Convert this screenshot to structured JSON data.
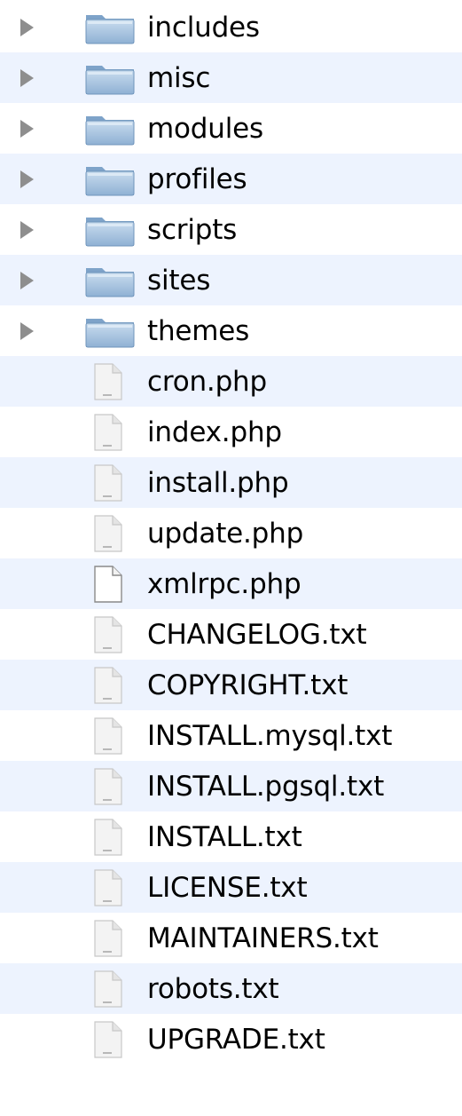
{
  "finder_list": {
    "row_colors": {
      "even": "#ffffff",
      "odd": "#edf3fe"
    },
    "items": [
      {
        "name": "includes",
        "kind": "folder",
        "icon": "folder-icon"
      },
      {
        "name": "misc",
        "kind": "folder",
        "icon": "folder-icon"
      },
      {
        "name": "modules",
        "kind": "folder",
        "icon": "folder-icon"
      },
      {
        "name": "profiles",
        "kind": "folder",
        "icon": "folder-icon"
      },
      {
        "name": "scripts",
        "kind": "folder",
        "icon": "folder-icon"
      },
      {
        "name": "sites",
        "kind": "folder",
        "icon": "folder-icon"
      },
      {
        "name": "themes",
        "kind": "folder",
        "icon": "folder-icon"
      },
      {
        "name": "cron.php",
        "kind": "file",
        "icon": "document-icon"
      },
      {
        "name": "index.php",
        "kind": "file",
        "icon": "document-icon"
      },
      {
        "name": "install.php",
        "kind": "file",
        "icon": "document-icon"
      },
      {
        "name": "update.php",
        "kind": "file",
        "icon": "document-icon"
      },
      {
        "name": "xmlrpc.php",
        "kind": "file",
        "icon": "blank-document-icon"
      },
      {
        "name": "CHANGELOG.txt",
        "kind": "file",
        "icon": "document-icon"
      },
      {
        "name": "COPYRIGHT.txt",
        "kind": "file",
        "icon": "document-icon"
      },
      {
        "name": "INSTALL.mysql.txt",
        "kind": "file",
        "icon": "document-icon"
      },
      {
        "name": "INSTALL.pgsql.txt",
        "kind": "file",
        "icon": "document-icon"
      },
      {
        "name": "INSTALL.txt",
        "kind": "file",
        "icon": "document-icon"
      },
      {
        "name": "LICENSE.txt",
        "kind": "file",
        "icon": "document-icon"
      },
      {
        "name": "MAINTAINERS.txt",
        "kind": "file",
        "icon": "document-icon"
      },
      {
        "name": "robots.txt",
        "kind": "file",
        "icon": "document-icon"
      },
      {
        "name": "UPGRADE.txt",
        "kind": "file",
        "icon": "document-icon"
      }
    ]
  }
}
